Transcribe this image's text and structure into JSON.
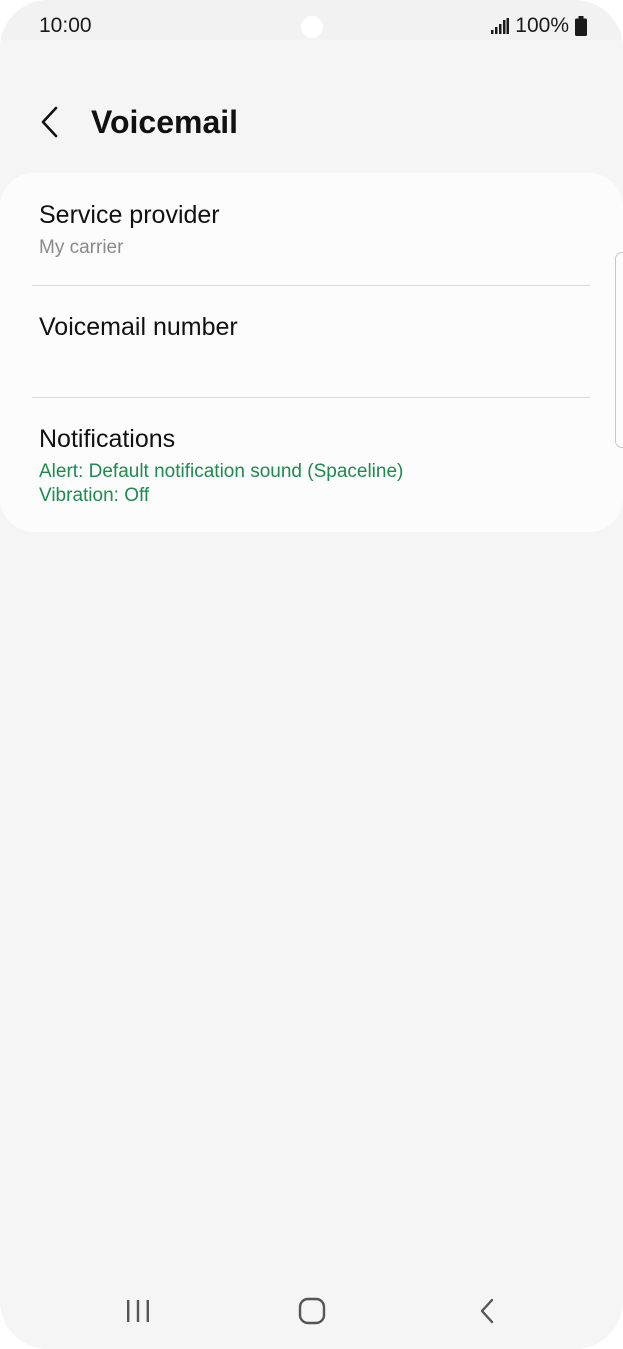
{
  "status_bar": {
    "time": "10:00",
    "battery": "100%",
    "icons": [
      "signal-icon",
      "battery-icon"
    ]
  },
  "header": {
    "title": "Voicemail",
    "back_icon": "back-arrow-icon"
  },
  "settings": {
    "items": [
      {
        "title": "Service provider",
        "subtitle": "My carrier"
      },
      {
        "title": "Voicemail number"
      },
      {
        "title": "Notifications",
        "subtitle_line1": "Alert: Default notification sound (Spaceline)",
        "subtitle_line2": "Vibration: Off"
      }
    ]
  },
  "nav_bar": {
    "icons": [
      "recent-apps-icon",
      "home-icon",
      "back-icon"
    ]
  },
  "colors": {
    "background": "#f5f5f5",
    "card": "#fcfcfc",
    "accent_green": "#1d8a4f",
    "secondary_text": "#8a8a8a",
    "primary_text": "#111111"
  }
}
